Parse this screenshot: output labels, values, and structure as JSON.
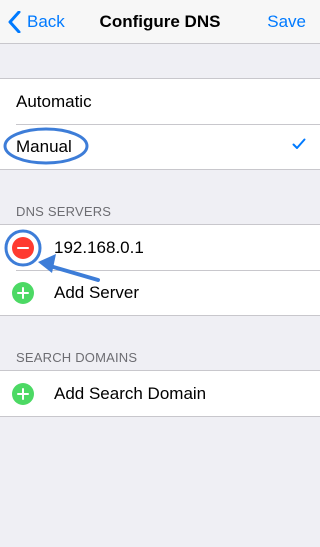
{
  "navbar": {
    "back_label": "Back",
    "title": "Configure DNS",
    "save_label": "Save"
  },
  "mode": {
    "options": [
      {
        "label": "Automatic",
        "selected": false
      },
      {
        "label": "Manual",
        "selected": true
      }
    ]
  },
  "dns_servers": {
    "header": "DNS SERVERS",
    "servers": [
      "192.168.0.1"
    ],
    "add_label": "Add Server"
  },
  "search_domains": {
    "header": "SEARCH DOMAINS",
    "add_label": "Add Search Domain"
  },
  "colors": {
    "accent": "#007aff",
    "delete": "#ff3b30",
    "add": "#4cd964",
    "annotation": "#3d7dd8"
  }
}
